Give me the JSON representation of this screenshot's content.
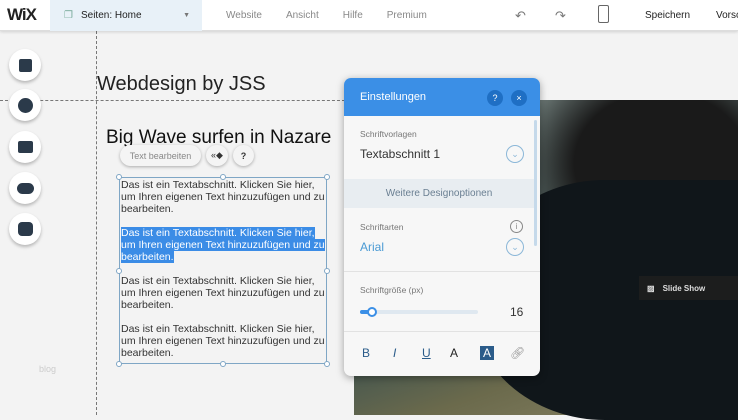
{
  "topbar": {
    "logo": "WiX",
    "pages_label": "Seiten: Home",
    "menu": [
      "Website",
      "Ansicht",
      "Hilfe",
      "Premium"
    ],
    "save": "Speichern",
    "preview": "Vorsc"
  },
  "canvas": {
    "site_title": "Webdesign by JSS",
    "heading": "Big Wave surfen in Nazare",
    "edit_text": "Text bearbeiten",
    "paragraphs": [
      "Das ist ein Textabschnitt. Klicken Sie hier, um Ihren eigenen Text hinzuzufügen und zu bearbeiten.",
      "Das ist ein Textabschnitt. Klicken Sie hier, um Ihren eigenen Text hinzuzufügen und zu bearbeiten.",
      "Das ist ein Textabschnitt. Klicken Sie hier, um Ihren eigenen Text hinzuzufügen und zu bearbeiten.",
      "Das ist ein Textabschnitt. Klicken Sie hier, um Ihren eigenen Text hinzuzufügen und zu bearbeiten."
    ],
    "blog": "blog",
    "slideshow": "Slide Show"
  },
  "panel": {
    "title": "Einstellungen",
    "help": "?",
    "close": "×",
    "templates_label": "Schriftvorlagen",
    "template_value": "Textabschnitt 1",
    "more_options": "Weitere Designoptionen",
    "fonts_label": "Schriftarten",
    "font_value": "Arial",
    "size_label": "Schriftgröße (px)",
    "size_value": "16",
    "size_fraction": 0.1,
    "format": {
      "bold": "B",
      "italic": "I",
      "underline": "U",
      "color": "A",
      "highlight": "A"
    }
  },
  "colors": {
    "accent": "#3b8fe6"
  }
}
